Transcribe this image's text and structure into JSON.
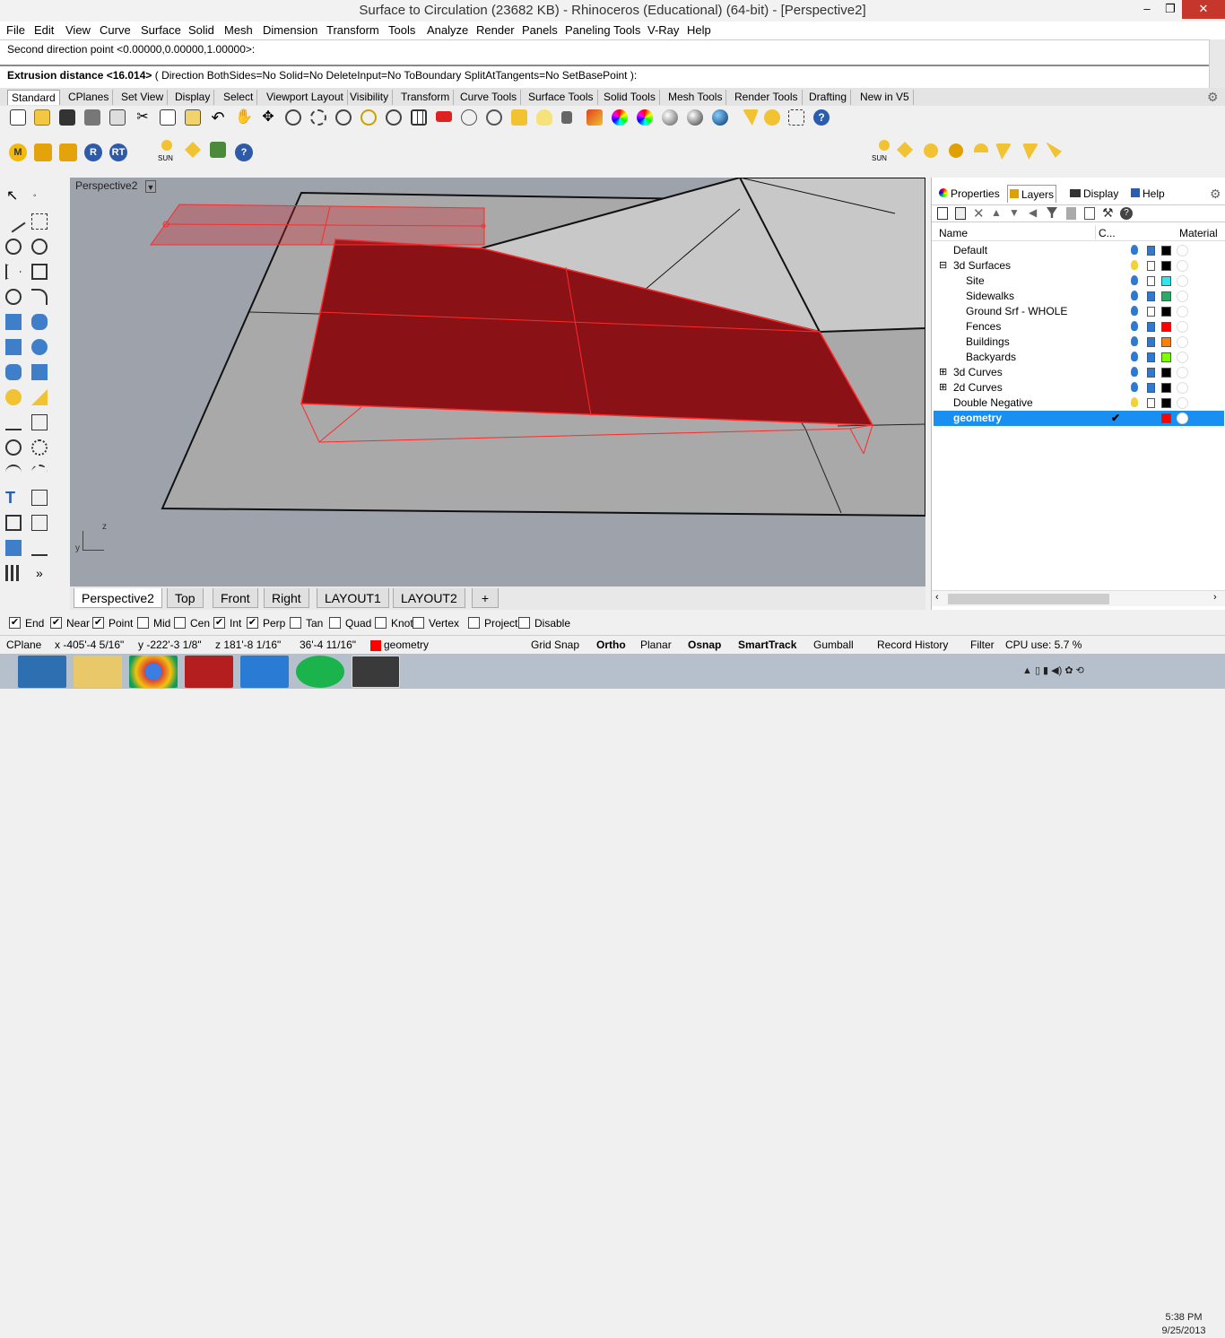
{
  "window": {
    "title": "Surface to Circulation (23682 KB) - Rhinoceros (Educational) (64-bit) - [Perspective2]",
    "min": "–",
    "max": "❐",
    "close": "✕"
  },
  "menu": [
    "File",
    "Edit",
    "View",
    "Curve",
    "Surface",
    "Solid",
    "Mesh",
    "Dimension",
    "Transform",
    "Tools",
    "Analyze",
    "Render",
    "Panels",
    "Paneling Tools",
    "V-Ray",
    "Help"
  ],
  "command": {
    "history": "Second direction point <0.00000,0.00000,1.00000>:",
    "prompt_bold": "Extrusion distance <16.014>",
    "prompt_rest": " ( Direction  BothSides=No  Solid=No  DeleteInput=No  ToBoundary  SplitAtTangents=No  SetBasePoint ):"
  },
  "toolbar_tabs": [
    "Standard",
    "CPlanes",
    "Set View",
    "Display",
    "Select",
    "Viewport Layout",
    "Visibility",
    "Transform",
    "Curve Tools",
    "Surface Tools",
    "Solid Tools",
    "Mesh Tools",
    "Render Tools",
    "Drafting",
    "New in V5"
  ],
  "render_tools": {
    "m": "M",
    "r": "R",
    "rt": "RT",
    "sun": "SUN",
    "help": "?"
  },
  "viewport": {
    "name": "Perspective2",
    "axis_z": "z",
    "axis_y": "y"
  },
  "viewport_tabs": [
    "Perspective2",
    "Top",
    "Front",
    "Right",
    "LAYOUT1",
    "LAYOUT2"
  ],
  "add_tab": "+",
  "panel": {
    "tabs": [
      "Properties",
      "Layers",
      "Display",
      "Help"
    ],
    "col_name": "Name",
    "col_c": "C...",
    "col_material": "Material",
    "layers": [
      {
        "name": "Default",
        "indent": 0,
        "color": "#000000",
        "lamp": "on",
        "lock": "locked"
      },
      {
        "name": "3d Surfaces",
        "indent": 0,
        "expander": "⊟",
        "color": "#000000",
        "lamp": "off",
        "lock": "unlocked"
      },
      {
        "name": "Site",
        "indent": 1,
        "color": "#2ee6f0",
        "lamp": "on",
        "lock": "unlocked"
      },
      {
        "name": "Sidewalks",
        "indent": 1,
        "color": "#2ea866",
        "lamp": "on",
        "lock": "locked"
      },
      {
        "name": "Ground Srf - WHOLE",
        "indent": 1,
        "color": "#000000",
        "lamp": "on",
        "lock": "unlocked"
      },
      {
        "name": "Fences",
        "indent": 1,
        "color": "#ff0000",
        "lamp": "on",
        "lock": "locked"
      },
      {
        "name": "Buildings",
        "indent": 1,
        "color": "#ff7f00",
        "lamp": "on",
        "lock": "locked"
      },
      {
        "name": "Backyards",
        "indent": 1,
        "color": "#7fff00",
        "lamp": "on",
        "lock": "locked"
      },
      {
        "name": "3d Curves",
        "indent": 0,
        "expander": "⊞",
        "color": "#000000",
        "lamp": "on",
        "lock": "locked"
      },
      {
        "name": "2d Curves",
        "indent": 0,
        "expander": "⊞",
        "color": "#000000",
        "lamp": "on",
        "lock": "locked"
      },
      {
        "name": "Double Negative",
        "indent": 0,
        "color": "#000000",
        "lamp": "off",
        "lock": "unlocked"
      },
      {
        "name": "geometry",
        "indent": 0,
        "color": "#ff0000",
        "current": "✔",
        "selected": true
      }
    ]
  },
  "osnaps": [
    {
      "label": "End",
      "checked": true
    },
    {
      "label": "Near",
      "checked": true
    },
    {
      "label": "Point",
      "checked": true
    },
    {
      "label": "Mid",
      "checked": false
    },
    {
      "label": "Cen",
      "checked": false
    },
    {
      "label": "Int",
      "checked": true
    },
    {
      "label": "Perp",
      "checked": true
    },
    {
      "label": "Tan",
      "checked": false
    },
    {
      "label": "Quad",
      "checked": false
    },
    {
      "label": "Knot",
      "checked": false
    },
    {
      "label": "Vertex",
      "checked": false
    },
    {
      "label": "Project",
      "checked": false
    },
    {
      "label": "Disable",
      "checked": false
    }
  ],
  "status": {
    "cplane": "CPlane",
    "x": "x -405'-4 5/16\"",
    "y": "y -222'-3 1/8\"",
    "z": "z 181'-8 1/16\"",
    "dist": "36'-4 11/16\"",
    "layer": "geometry",
    "layer_color": "#ff0000",
    "grid_snap": "Grid Snap",
    "ortho": "Ortho",
    "planar": "Planar",
    "osnap": "Osnap",
    "smarttrack": "SmartTrack",
    "gumball": "Gumball",
    "record_history": "Record History",
    "filter": "Filter",
    "cpu": "CPU use: 5.7 %"
  },
  "clock": {
    "time": "5:38 PM",
    "date": "9/25/2013"
  },
  "colors": {
    "selected_row": "#1a8ff2",
    "surface_red": "#8a1216",
    "viewport_bg": "#9ea3ab"
  }
}
